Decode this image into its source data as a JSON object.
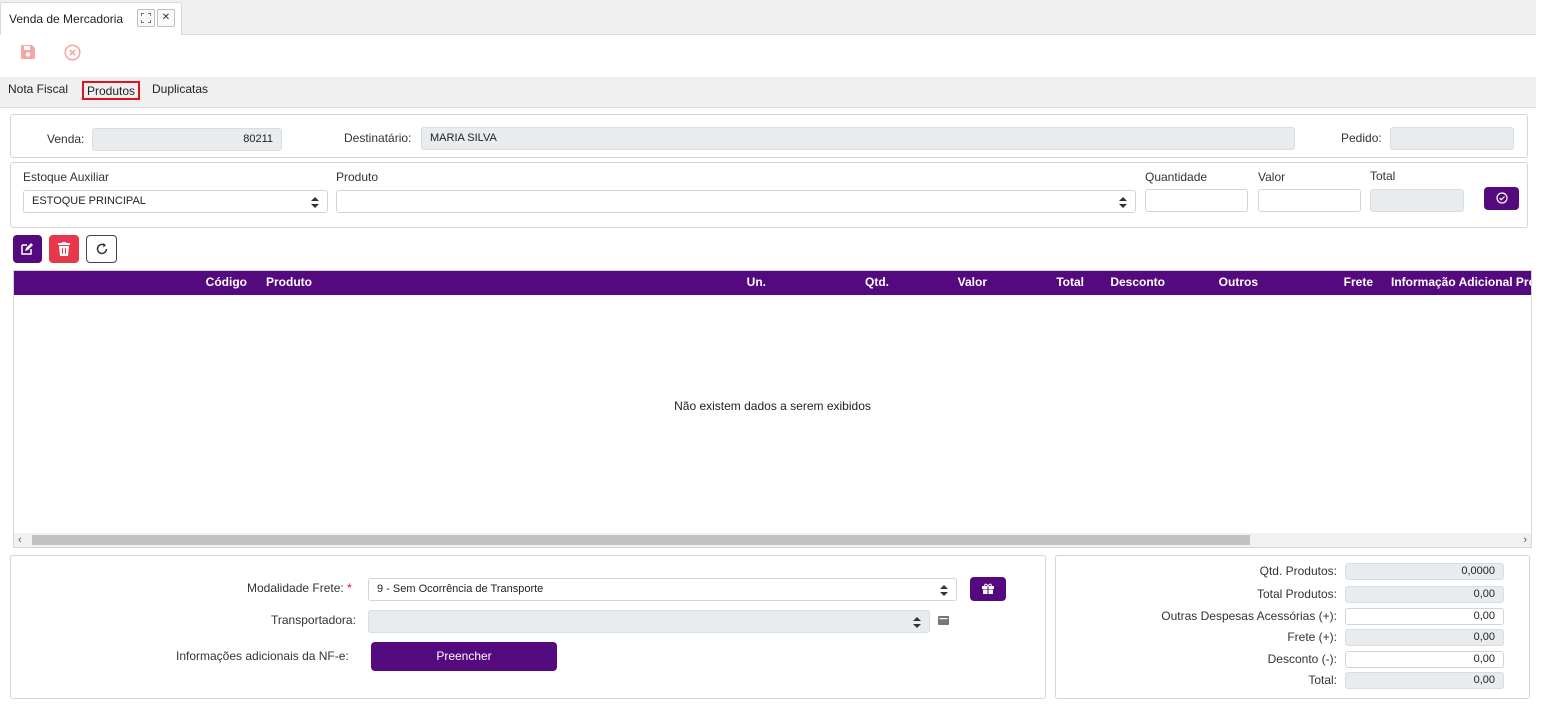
{
  "window": {
    "tab_title": "Venda de Mercadoria",
    "expand_glyph": "⛶",
    "close_glyph": "✕"
  },
  "toolbar": {
    "save_icon": "save-icon",
    "cancel_icon": "cancel-circle-icon",
    "icon_color": "#f4a6a6"
  },
  "subtabs": [
    {
      "label": "Nota Fiscal",
      "active": false
    },
    {
      "label": "Produtos",
      "active": true
    },
    {
      "label": "Duplicatas",
      "active": false
    }
  ],
  "header": {
    "venda_label": "Venda:",
    "venda_value": "80211",
    "destinatario_label": "Destinatário:",
    "destinatario_value": "MARIA SILVA",
    "pedido_label": "Pedido:",
    "pedido_value": ""
  },
  "entry": {
    "estoque_label": "Estoque Auxiliar",
    "estoque_value": "ESTOQUE PRINCIPAL",
    "produto_label": "Produto",
    "produto_value": "",
    "quantidade_label": "Quantidade",
    "quantidade_value": "",
    "valor_label": "Valor",
    "valor_value": "",
    "total_label": "Total",
    "total_value": ""
  },
  "grid": {
    "columns": [
      "Código",
      "Produto",
      "Un.",
      "Qtd.",
      "Valor",
      "Total",
      "Desconto",
      "Outros",
      "Frete",
      "Informação Adicional Pro"
    ],
    "empty_message": "Não existem dados a serem exibidos",
    "rows": []
  },
  "footer": {
    "modalidade_label": "Modalidade Frete:",
    "required_mark": "*",
    "modalidade_value": "9 - Sem Ocorrência de Transporte",
    "transportadora_label": "Transportadora:",
    "transportadora_value": "",
    "info_label": "Informações adicionais da NF-e:",
    "preencher_label": "Preencher"
  },
  "totals": [
    {
      "label": "Qtd. Produtos:",
      "value": "0,0000",
      "readonly": true
    },
    {
      "label": "Total Produtos:",
      "value": "0,00",
      "readonly": true
    },
    {
      "label": "Outras Despesas Acessórias (+):",
      "value": "0,00",
      "readonly": false
    },
    {
      "label": "Frete (+):",
      "value": "0,00",
      "readonly": true
    },
    {
      "label": "Desconto (-):",
      "value": "0,00",
      "readonly": false
    },
    {
      "label": "Total:",
      "value": "0,00",
      "readonly": true
    }
  ],
  "colors": {
    "accent": "#55097f",
    "danger": "#e8364a",
    "active_tab_border": "#e0141e"
  }
}
